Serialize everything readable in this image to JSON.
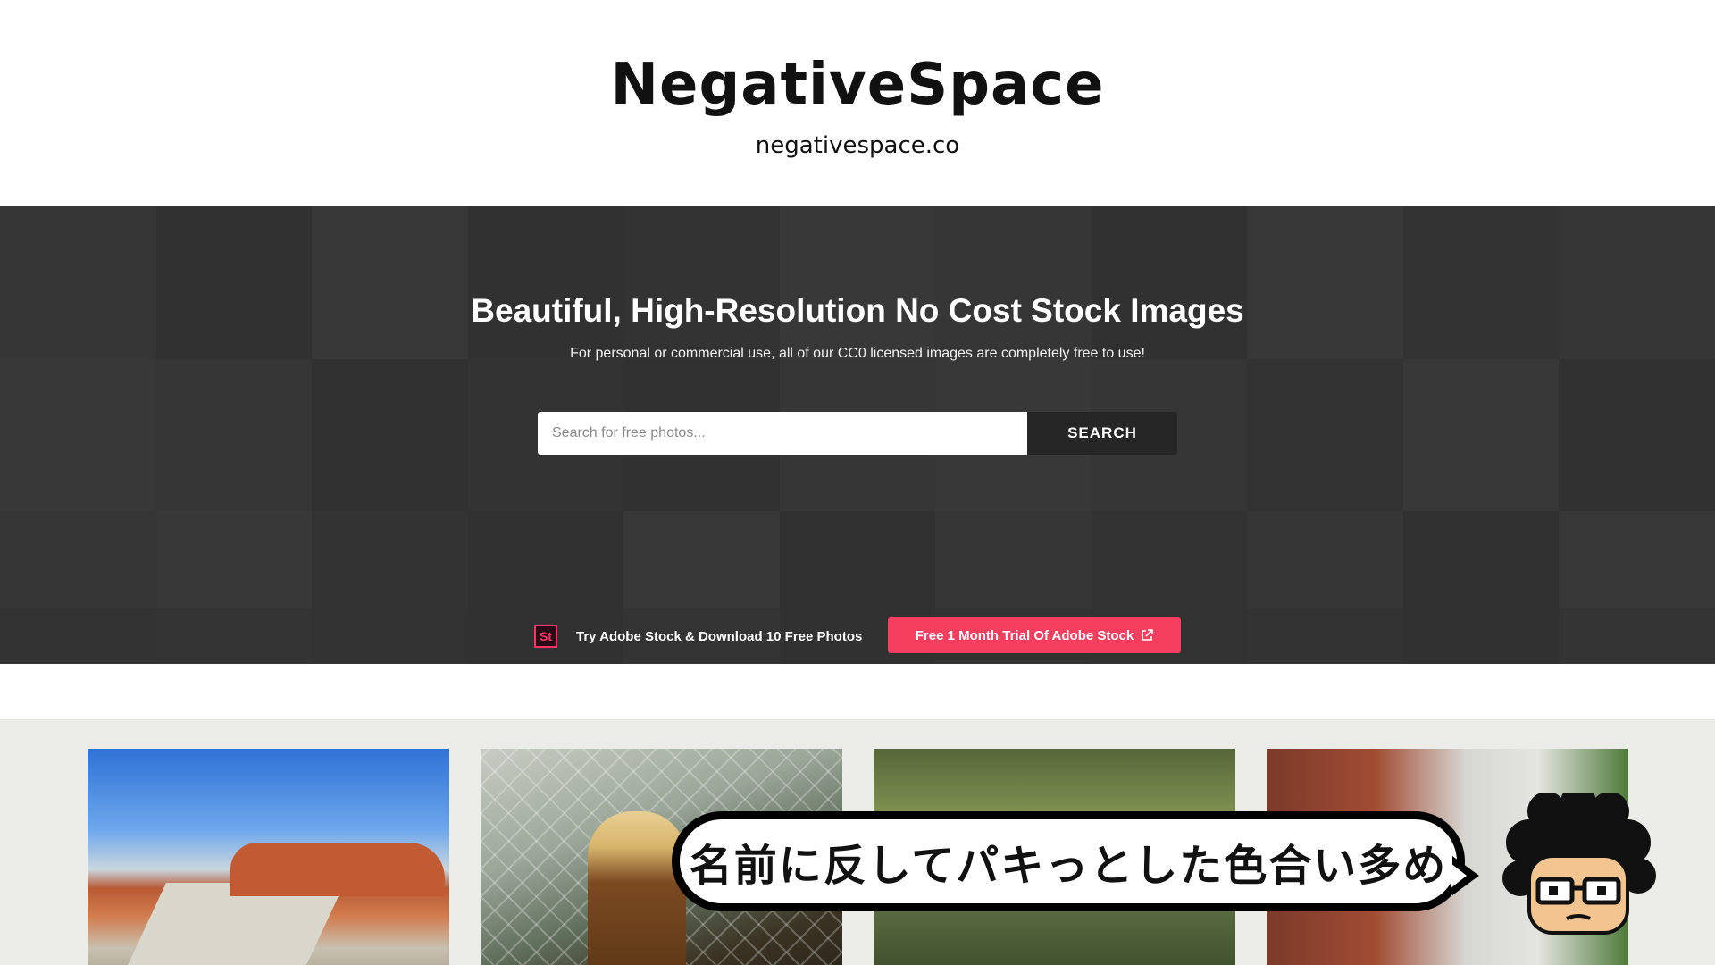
{
  "header": {
    "title": "NegativeSpace",
    "url": "negativespace.co"
  },
  "hero": {
    "heading": "Beautiful, High-Resolution No Cost Stock Images",
    "subheading": "For personal or commercial use, all of our CC0 licensed images are completely free to use!",
    "search": {
      "placeholder": "Search for free photos...",
      "button_label": "SEARCH"
    },
    "promo": {
      "icon_text": "St",
      "text": "Try Adobe Stock & Download 10 Free Photos",
      "button_label": "Free 1 Month Trial Of Adobe Stock"
    }
  },
  "overlay": {
    "caption": "名前に反してパキっとした色合い多め"
  },
  "colors": {
    "accent": "#f63e5f",
    "hero_bg": "#3a3a3a",
    "search_button_bg": "#262626",
    "gallery_bg": "#ebebe7"
  },
  "icons": {
    "external_link": "external-link-icon",
    "adobe_stock": "adobe-stock-icon"
  }
}
